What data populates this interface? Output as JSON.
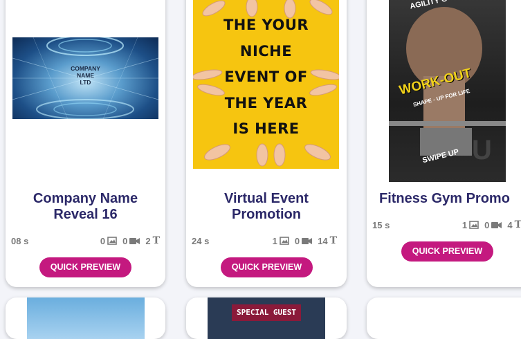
{
  "cards": [
    {
      "title": "Company Name Reveal 16",
      "duration": "08 s",
      "images": "0",
      "videos": "0",
      "texts": "2",
      "button": "QUICK PREVIEW",
      "thumb_text": [
        "COMPANY",
        "NAME",
        "LTD"
      ]
    },
    {
      "title": "Virtual Event Promotion",
      "duration": "24 s",
      "images": "1",
      "videos": "0",
      "texts": "14",
      "button": "QUICK PREVIEW",
      "thumb_text": [
        "THE YOUR",
        "NICHE",
        "EVENT OF",
        "THE YEAR",
        "IS HERE"
      ]
    },
    {
      "title": "Fitness Gym Promo",
      "duration": "15 s",
      "images": "1",
      "videos": "0",
      "texts": "4",
      "button": "QUICK PREVIEW",
      "thumb_text": [
        "AGILITY G",
        "WORK-OUT",
        "SHAPE - UP FOR LIFE",
        "SWIPE UP"
      ]
    }
  ],
  "row2": {
    "special_guest": "SPECIAL GUEST"
  },
  "colors": {
    "title": "#2b2868",
    "button": "#c4197f",
    "yellow": "#f6c510"
  },
  "icons": [
    "image-icon",
    "video-icon",
    "text-icon"
  ]
}
